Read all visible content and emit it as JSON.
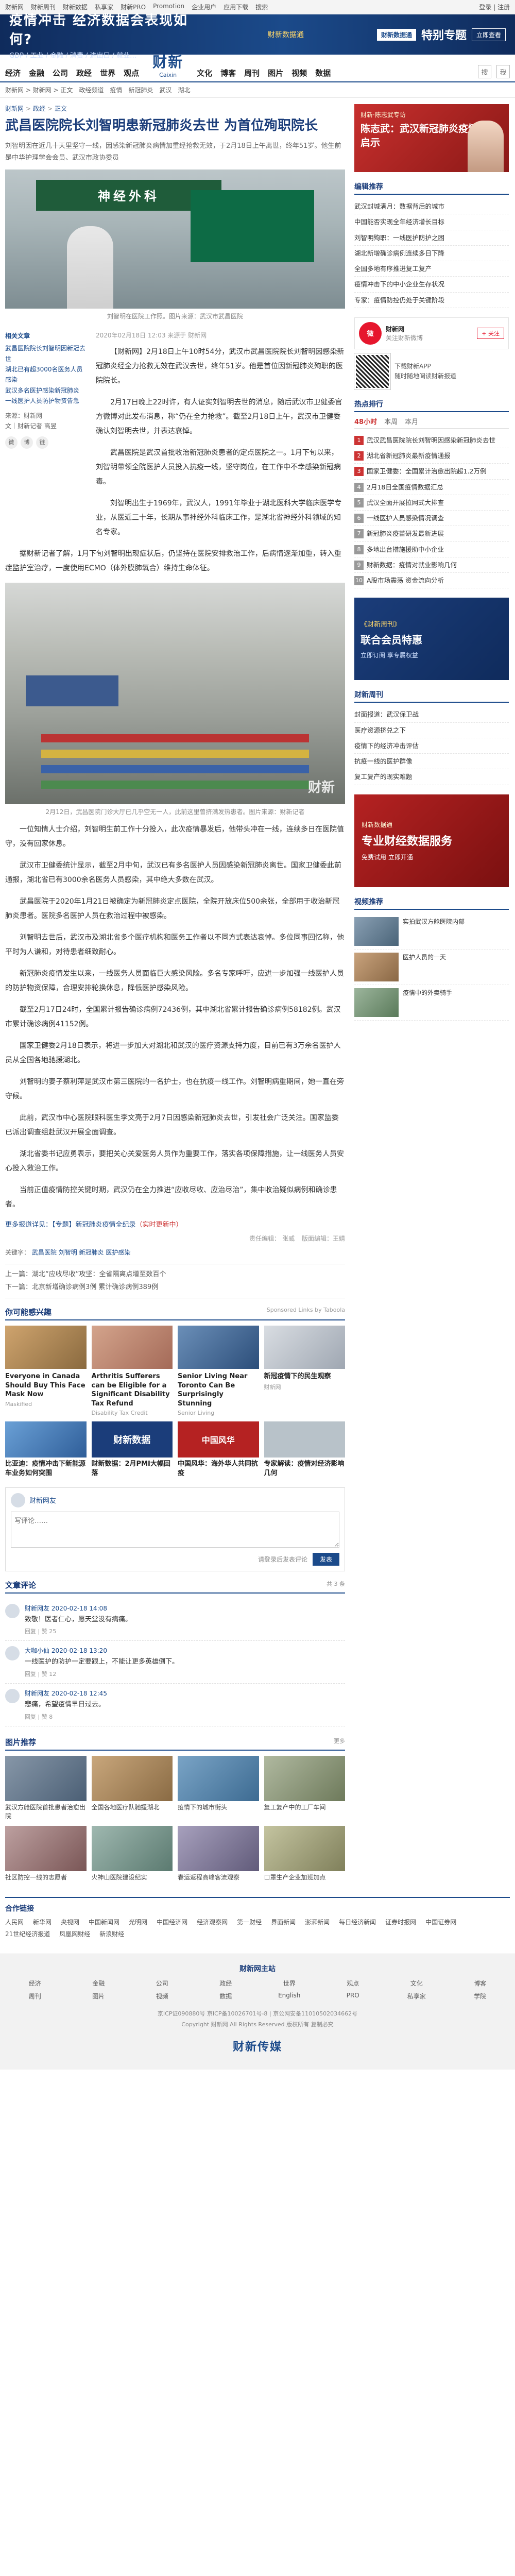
{
  "topbar": {
    "links": [
      "财新网",
      "财新周刊",
      "财新数据",
      "私享家",
      "财新PRO",
      "Promotion",
      "企业用户",
      "应用下载",
      "搜索"
    ],
    "right": "登录 | 注册"
  },
  "banner": {
    "title": "疫情冲击 经济数据会表现如何?",
    "subtitle": "GDP / 工业 / 金融 / 消费 / 进出口 / 就业…",
    "mid": "财新数据通",
    "badge": "财新数据通",
    "special": "特别专题",
    "button": "立即查看"
  },
  "header": {
    "nav_left": [
      "经济",
      "金融",
      "公司",
      "政经",
      "世界",
      "观点"
    ],
    "logo_cn": "财新",
    "logo_en": "Caixin",
    "nav_right": [
      "文化",
      "博客",
      "周刊",
      "图片",
      "视频",
      "数据"
    ],
    "tools": {
      "search_label": "搜",
      "user_label": "我"
    }
  },
  "subnav": [
    "财新网 > 财新网 > 正文",
    "政经频道",
    "疫情",
    "新冠肺炎",
    "武汉",
    "湖北"
  ],
  "breadcrumb": {
    "home": "财新网",
    "channel": "政经",
    "current": "正文",
    "separator": ">"
  },
  "article": {
    "title": "武昌医院院长刘智明患新冠肺炎去世 为首位殉职院长",
    "lead": "刘智明因在近几十天里坚守一线，因感染新冠肺炎病情加重经抢救无效，于2月18日上午离世，终年51岁。他生前是中华护理学会会员、武汉市政协委员",
    "photo_caption": "刘智明在医院工作照。图片来源：武汉市武昌医院",
    "info": {
      "title": "相关文章",
      "items": [
        "武昌医院院长刘智明因新冠去世",
        "湖北已有超3000名医务人员感染",
        "武汉多名医护感染新冠肺炎",
        "一线医护人员防护物资告急"
      ],
      "source_label": "来源：财新网",
      "author": "文｜财新记者 高昱"
    },
    "share": [
      "微",
      "博",
      "链"
    ],
    "byline": "2020年02月18日 12:03   来源于 财新网",
    "paragraphs": [
      "【财新网】2月18日上午10时54分，武汉市武昌医院院长刘智明因感染新冠肺炎经全力抢救无效在武汉去世，终年51岁。他是首位因新冠肺炎殉职的医院院长。",
      "2月17日晚上22时许，有人证实刘智明去世的消息，随后武汉市卫健委官方微博对此发布消息，称“仍在全力抢救”。截至2月18日上午，武汉市卫健委确认刘智明去世，并表达哀悼。",
      "武昌医院是武汉首批收治新冠肺炎患者的定点医院之一。1月下旬以来，刘智明带领全院医护人员投入抗疫一线，坚守岗位，在工作中不幸感染新冠病毒。",
      "刘智明出生于1969年，武汉人，1991年毕业于湖北医科大学临床医学专业，从医近三十年，长期从事神经外科临床工作，是湖北省神经外科领域的知名专家。",
      "据财新记者了解，1月下旬刘智明出现症状后，仍坚持在医院安排救治工作，后病情逐渐加重，转入重症监护室治疗，一度使用ECMO（体外膜肺氧合）维持生命体征。"
    ],
    "photo2_caption": "2月12日，武昌医院门诊大厅已几乎空无一人，此前这里曾挤满发热患者。图片来源：财新记者",
    "paragraphs2": [
      "一位知情人士介绍，刘智明生前工作十分投入，此次疫情暴发后，他带头冲在一线，连续多日在医院值守，没有回家休息。",
      "武汉市卫健委统计显示，截至2月中旬，武汉已有多名医护人员因感染新冠肺炎离世。国家卫健委此前通报，湖北省已有3000余名医务人员感染，其中绝大多数在武汉。",
      "武昌医院于2020年1月21日被确定为新冠肺炎定点医院，全院开放床位500余张，全部用于收治新冠肺炎患者。医院多名医护人员在救治过程中被感染。",
      "刘智明去世后，武汉市及湖北省多个医疗机构和医务工作者以不同方式表达哀悼。多位同事回忆称，他平时为人谦和，对待患者细致耐心。",
      "新冠肺炎疫情发生以来，一线医务人员面临巨大感染风险。多名专家呼吁，应进一步加强一线医护人员的防护物资保障，合理安排轮换休息，降低医护感染风险。",
      "截至2月17日24时，全国累计报告确诊病例72436例，其中湖北省累计报告确诊病例58182例。武汉市累计确诊病例41152例。",
      "国家卫健委2月18日表示，将进一步加大对湖北和武汉的医疗资源支持力度，目前已有3万余名医护人员从全国各地驰援湖北。",
      "刘智明的妻子蔡利萍是武汉市第三医院的一名护士，也在抗疫一线工作。刘智明病重期间，她一直在旁守候。",
      "此前，武汉市中心医院眼科医生李文亮于2月7日因感染新冠肺炎去世，引发社会广泛关注。国家监委已派出调查组赴武汉开展全面调查。",
      "湖北省委书记应勇表示，要把关心关爱医务人员作为重要工作，落实各项保障措施，让一线医务人员安心投入救治工作。",
      "当前正值疫情防控关键时期，武汉仍在全力推进“应收尽收、应治尽治”，集中收治疑似病例和确诊患者。"
    ],
    "note_prefix": "更多报道详见：",
    "note_link": "【专题】新冠肺炎疫情全纪录",
    "note_more": "（实时更新中）",
    "editor_label": "责任编辑：",
    "editor": "张威",
    "editor_extra": "版面编辑：王婧",
    "tags_label": "关键字：",
    "tags": [
      "武昌医院",
      "刘智明",
      "新冠肺炎",
      "医护感染"
    ],
    "prev": "上一篇：湖北“应收尽收”攻坚：全省隔离点增至数百个",
    "next": "下一篇：北京新增确诊病例3例 累计确诊病例389例"
  },
  "recommended": {
    "title": "你可能感兴趣",
    "extra": "Sponsored Links by Taboola",
    "cards": [
      {
        "title": "Everyone in Canada Should Buy This Face Mask Now",
        "src": "Maskified"
      },
      {
        "title": "Arthritis Sufferers can be Eligible for a Significant Disability Tax Refund",
        "src": "Disability Tax Credit"
      },
      {
        "title": "Senior Living Near Toronto Can Be Surprisingly Stunning",
        "src": "Senior Living"
      },
      {
        "title": "新冠疫情下的民生观察",
        "src": "财新网"
      }
    ],
    "small": [
      {
        "title": "比亚迪：疫情冲击下新能源车业务如何突围",
        "img": ""
      },
      {
        "title": "财新数据：2月PMI大幅回落",
        "img": "财新数据"
      },
      {
        "title": "中国风华：海外华人共同抗疫",
        "img": "中国风华"
      },
      {
        "title": "专家解读：疫情对经济影响几何",
        "img": ""
      }
    ]
  },
  "comment": {
    "user": "财新网友",
    "placeholder": "写评论……",
    "login_hint": "请登录后发表评论",
    "submit": "发表"
  },
  "comments": {
    "title": "文章评论",
    "count": "共 3 条",
    "items": [
      {
        "user": "财新网友 2020-02-18 14:08",
        "text": "致敬！医者仁心，愿天堂没有病痛。",
        "actions": "回复 | 赞 25"
      },
      {
        "user": "大咖小仙 2020-02-18 13:20",
        "text": "一线医护的防护一定要跟上，不能让更多英雄倒下。",
        "actions": "回复 | 赞 12"
      },
      {
        "user": "财新网友 2020-02-18 12:45",
        "text": "悲痛，希望疫情早日过去。",
        "actions": "回复 | 赞 8"
      }
    ]
  },
  "pictures": {
    "title": "图片推荐",
    "more": "更多",
    "row1": [
      "武汉方舱医院首批患者治愈出院",
      "全国各地医疗队驰援湖北",
      "疫情下的城市街头",
      "复工复产中的工厂车间"
    ],
    "row2": [
      "社区防控一线的志愿者",
      "火神山医院建设纪实",
      "春运返程高峰客流观察",
      "口罩生产企业加班加点"
    ]
  },
  "sidebar": {
    "feature": {
      "label": "财新·陈志武专访",
      "title": "陈志武：武汉新冠肺炎疫情后的启示"
    },
    "hot_title": "编辑推荐",
    "hot": [
      "武汉封城满月：数据背后的城市",
      "中国能否实现全年经济增长目标",
      "刘智明殉职：一线医护防护之困",
      "湖北新增确诊病例连续多日下降",
      "全国多地有序推进复工复产",
      "疫情冲击下的中小企业生存状况",
      "专家：疫情防控仍处于关键阶段"
    ],
    "weibo": {
      "name": "财新网",
      "desc": "关注财新微博",
      "follow": "+ 关注"
    },
    "app": {
      "text": "下载财新APP\n随时随地阅读财新报道"
    },
    "rank_title": "热点排行",
    "rank_tabs": [
      "48小时",
      "本周",
      "本月"
    ],
    "rank": [
      "武汉武昌医院院长刘智明因感染新冠肺炎去世",
      "湖北省新冠肺炎最新疫情通报",
      "国家卫健委：全国累计治愈出院超1.2万例",
      "2月18日全国疫情数据汇总",
      "武汉全面开展拉网式大排查",
      "一线医护人员感染情况调查",
      "新冠肺炎疫苗研发最新进展",
      "多地出台措施援助中小企业",
      "财新数据：疫情对就业影响几何",
      "A股市场震荡 资金流向分析"
    ],
    "ad1": {
      "t1": "《财新周刊》",
      "t2": "联合会员特惠",
      "t3": "立即订阅 享专属权益"
    },
    "mag_title": "财新周刊",
    "mag": [
      "封面报道：武汉保卫战",
      "医疗资源挤兑之下",
      "疫情下的经济冲击评估",
      "抗疫一线的医护群像",
      "复工复产的现实难题"
    ],
    "ad2": {
      "t1": "财新数据通",
      "t2": "专业财经数据服务",
      "t3": "免费试用 立即开通"
    },
    "video_title": "视频推荐",
    "video": [
      "实拍武汉方舱医院内部",
      "医护人员的一天",
      "疫情中的外卖骑手"
    ]
  },
  "footer": {
    "links_title": "合作链接",
    "links": [
      "人民网",
      "新华网",
      "央视网",
      "中国新闻网",
      "光明网",
      "中国经济网",
      "经济观察网",
      "第一财经",
      "界面新闻",
      "澎湃新闻",
      "每日经济新闻",
      "证券时报网",
      "中国证券网",
      "21世纪经济报道",
      "凤凰网财经",
      "新浪财经"
    ],
    "nav_title": "财新网主站",
    "nav": [
      "经济",
      "金融",
      "公司",
      "政经",
      "世界",
      "观点",
      "文化",
      "博客",
      "周刊",
      "图片",
      "视频",
      "数据",
      "English",
      "PRO",
      "私享家",
      "学院"
    ],
    "copyright": "京ICP证090880号 京ICP备10026701号-8 | 京公网安备11010502034662号",
    "copyright2": "Copyright 财新网 All Rights Reserved 版权所有 复制必究",
    "logo": "财新传媒"
  }
}
